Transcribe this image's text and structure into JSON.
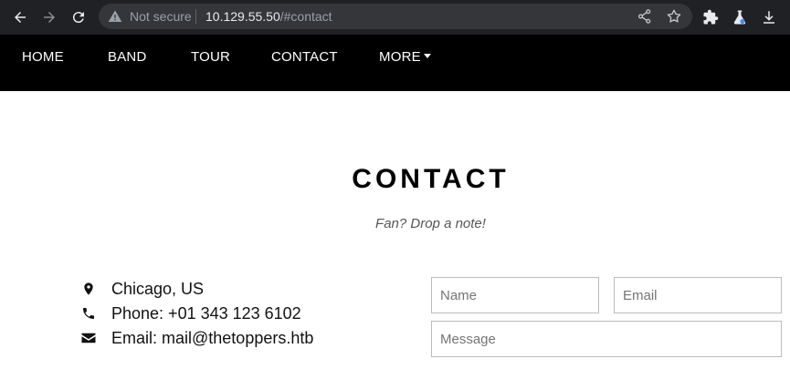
{
  "browser": {
    "security_label": "Not secure",
    "url_host": "10.129.55.50",
    "url_path": "/#contact"
  },
  "nav": {
    "items": [
      {
        "label": "HOME"
      },
      {
        "label": "BAND"
      },
      {
        "label": "TOUR"
      },
      {
        "label": "CONTACT"
      },
      {
        "label": "MORE"
      }
    ]
  },
  "contact": {
    "title": "CONTACT",
    "subtitle": "Fan? Drop a note!",
    "location": "Chicago, US",
    "phone": "Phone: +01 343 123 6102",
    "email": "Email: mail@thetoppers.htb"
  },
  "form": {
    "name_placeholder": "Name",
    "email_placeholder": "Email",
    "message_placeholder": "Message"
  },
  "icons": {
    "back": "back-arrow-icon",
    "forward": "forward-arrow-icon",
    "reload": "reload-icon",
    "warning": "warning-icon",
    "share": "share-icon",
    "bookmark": "star-icon",
    "extensions": "puzzle-icon",
    "labs": "flask-icon",
    "download": "download-icon",
    "location": "map-marker-icon",
    "phone": "phone-icon",
    "email": "envelope-icon"
  },
  "colors": {
    "chrome_bg": "#202124",
    "omnibox_bg": "#35363a",
    "nav_bg": "#000000",
    "page_bg": "#ffffff"
  }
}
